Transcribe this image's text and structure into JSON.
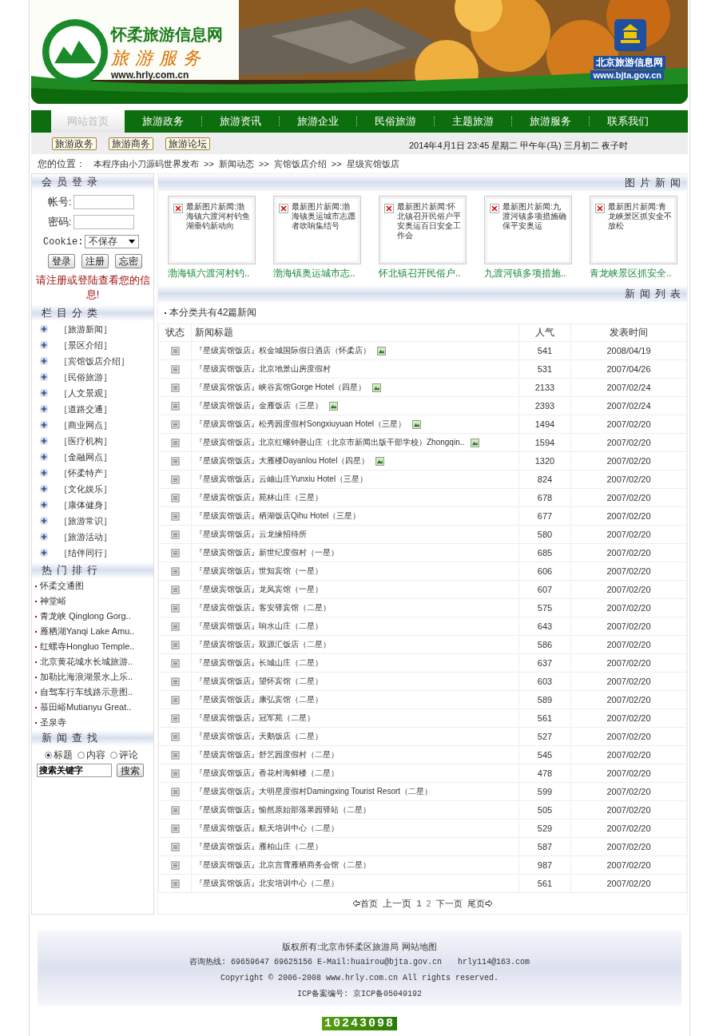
{
  "header": {
    "site_name": "怀柔旅游信息网",
    "slogan": "旅游服务",
    "url": "www.hrly.com.cn",
    "partner_name": "北京旅游信息网",
    "partner_url": "www.bjta.gov.cn"
  },
  "nav": [
    {
      "label": "网站首页",
      "selected": true
    },
    {
      "label": "旅游政务",
      "selected": false
    },
    {
      "label": "旅游资讯",
      "selected": false
    },
    {
      "label": "旅游企业",
      "selected": false
    },
    {
      "label": "民俗旅游",
      "selected": false
    },
    {
      "label": "主题旅游",
      "selected": false
    },
    {
      "label": "旅游服务",
      "selected": false
    },
    {
      "label": "联系我们",
      "selected": false
    }
  ],
  "subnav": {
    "buttons": [
      "旅游政务",
      "旅游商务",
      "旅游论坛"
    ],
    "datetime": "2014年4月1日 23:45 星期二 甲午年(马) 三月初二 夜子时"
  },
  "breadcrumb": {
    "label": "您的位置：",
    "separator": ">>",
    "items": [
      "本程序由小刀源码世界发布",
      "新闻动态",
      "宾馆饭店介绍",
      "星级宾馆饭店"
    ]
  },
  "login": {
    "title": "会员登录",
    "account_label": "帐号:",
    "password_label": "密码:",
    "cookie_label": "Cookie:",
    "cookie_value": "不保存",
    "buttons": [
      "登录",
      "注册",
      "忘密"
    ],
    "notice": "请注册或登陆查看您的信息!"
  },
  "categories": {
    "title": "栏目分类",
    "items": [
      "［旅游新闻］",
      "［景区介绍］",
      "［宾馆饭店介绍］",
      "［民俗旅游］",
      "［人文景观］",
      "［道路交通］",
      "［商业网点］",
      "［医疗机构］",
      "［金融网点］",
      "［怀柔特产］",
      "［文化娱乐］",
      "［康体健身］",
      "［旅游常识］",
      "［旅游活动］",
      "［结伴同行］"
    ]
  },
  "hot": {
    "title": "热门排行",
    "items": [
      "怀柔交通图",
      "神堂峪",
      "青龙峡 Qinglong Gorg..",
      "雁栖湖Yanqi Lake Amu..",
      "红螺寺Hongluo Temple..",
      "北京黄花城水长城旅游..",
      "加勒比海浪湖景水上乐..",
      "自驾车行车线路示意图..",
      "慕田峪Mutianyu Great..",
      "圣泉寺"
    ]
  },
  "search": {
    "title": "新闻查找",
    "options": [
      {
        "label": "标题",
        "selected": true
      },
      {
        "label": "内容",
        "selected": false
      },
      {
        "label": "评论",
        "selected": false
      }
    ],
    "value": "搜索关键字",
    "button": "搜索"
  },
  "photo_news": {
    "title": "图片新闻",
    "items": [
      {
        "alt": "最新图片新闻:渤海镇六渡河村钓鱼湖垂钓新动向",
        "caption": "渤海镇六渡河村钓.."
      },
      {
        "alt": "最新图片新闻:渤海镇奥运城市志愿者吹响集结号",
        "caption": "渤海镇奥运城市志.."
      },
      {
        "alt": "最新图片新闻:怀北镇召开民俗户平安奥运百日安全工作会",
        "caption": "怀北镇召开民俗户.."
      },
      {
        "alt": "最新图片新闻:九渡河镇多项措施确保平安奥运",
        "caption": "九渡河镇多项措施.."
      },
      {
        "alt": "最新图片新闻:青龙峡景区抓安全不放松",
        "caption": "青龙峡景区抓安全.."
      }
    ]
  },
  "news_list": {
    "title": "新闻列表",
    "summary": "本分类共有42篇新闻",
    "columns": [
      "状态",
      "新闻标题",
      "人气",
      "发表时间"
    ],
    "rows": [
      {
        "title": "『星级宾馆饭店』权金城国际假日酒店（怀柔店）",
        "has_image": true,
        "views": "541",
        "date": "2008/04/19"
      },
      {
        "title": "『星级宾馆饭店』北京地景山房度假村",
        "has_image": false,
        "views": "531",
        "date": "2007/04/26"
      },
      {
        "title": "『星级宾馆饭店』峡谷宾馆Gorge Hotel（四星）",
        "has_image": true,
        "views": "2133",
        "date": "2007/02/24"
      },
      {
        "title": "『星级宾馆饭店』金雁饭店（三星）",
        "has_image": true,
        "views": "2393",
        "date": "2007/02/24"
      },
      {
        "title": "『星级宾馆饭店』松秀园度假村Songxiuyuan Hotel（三星）",
        "has_image": true,
        "views": "1494",
        "date": "2007/02/20"
      },
      {
        "title": "『星级宾馆饭店』北京红螺钟磬山庄（北京市新闻出版干部学校）Zhongqin..",
        "has_image": true,
        "views": "1594",
        "date": "2007/02/20"
      },
      {
        "title": "『星级宾馆饭店』大雁楼Dayanlou Hotel（四星）",
        "has_image": true,
        "views": "1320",
        "date": "2007/02/20"
      },
      {
        "title": "『星级宾馆饭店』云岫山庄Yunxiu Hotel（三星）",
        "has_image": false,
        "views": "824",
        "date": "2007/02/20"
      },
      {
        "title": "『星级宾馆饭店』苑林山庄（三星）",
        "has_image": false,
        "views": "678",
        "date": "2007/02/20"
      },
      {
        "title": "『星级宾馆饭店』栖湖饭店Qihu Hotel（三星）",
        "has_image": false,
        "views": "677",
        "date": "2007/02/20"
      },
      {
        "title": "『星级宾馆饭店』云龙缘招待所",
        "has_image": false,
        "views": "580",
        "date": "2007/02/20"
      },
      {
        "title": "『星级宾馆饭店』新世纪度假村（一星）",
        "has_image": false,
        "views": "685",
        "date": "2007/02/20"
      },
      {
        "title": "『星级宾馆饭店』世知宾馆（一星）",
        "has_image": false,
        "views": "606",
        "date": "2007/02/20"
      },
      {
        "title": "『星级宾馆饭店』龙凤宾馆（一星）",
        "has_image": false,
        "views": "607",
        "date": "2007/02/20"
      },
      {
        "title": "『星级宾馆饭店』客安驿宾馆（二星）",
        "has_image": false,
        "views": "575",
        "date": "2007/02/20"
      },
      {
        "title": "『星级宾馆饭店』响水山庄（二星）",
        "has_image": false,
        "views": "643",
        "date": "2007/02/20"
      },
      {
        "title": "『星级宾馆饭店』双源汇饭店（二星）",
        "has_image": false,
        "views": "586",
        "date": "2007/02/20"
      },
      {
        "title": "『星级宾馆饭店』长城山庄（二星）",
        "has_image": false,
        "views": "637",
        "date": "2007/02/20"
      },
      {
        "title": "『星级宾馆饭店』望怀宾馆（二星）",
        "has_image": false,
        "views": "603",
        "date": "2007/02/20"
      },
      {
        "title": "『星级宾馆饭店』康弘宾馆（二星）",
        "has_image": false,
        "views": "589",
        "date": "2007/02/20"
      },
      {
        "title": "『星级宾馆饭店』冠军苑（二星）",
        "has_image": false,
        "views": "561",
        "date": "2007/02/20"
      },
      {
        "title": "『星级宾馆饭店』天鹅饭店（二星）",
        "has_image": false,
        "views": "527",
        "date": "2007/02/20"
      },
      {
        "title": "『星级宾馆饭店』舒艺园度假村（二星）",
        "has_image": false,
        "views": "545",
        "date": "2007/02/20"
      },
      {
        "title": "『星级宾馆饭店』香花村海鲜楼（二星）",
        "has_image": false,
        "views": "478",
        "date": "2007/02/20"
      },
      {
        "title": "『星级宾馆饭店』大明星度假村Damingxing Tourist Resort（二星）",
        "has_image": false,
        "views": "599",
        "date": "2007/02/20"
      },
      {
        "title": "『星级宾馆饭店』愉然原始部落果园驿站（二星）",
        "has_image": false,
        "views": "505",
        "date": "2007/02/20"
      },
      {
        "title": "『星级宾馆饭店』航天培训中心（二星）",
        "has_image": false,
        "views": "529",
        "date": "2007/02/20"
      },
      {
        "title": "『星级宾馆饭店』雁柏山庄（二星）",
        "has_image": false,
        "views": "587",
        "date": "2007/02/20"
      },
      {
        "title": "『星级宾馆饭店』北京宫霄雁栖商务会馆（二星）",
        "has_image": false,
        "views": "987",
        "date": "2007/02/20"
      },
      {
        "title": "『星级宾馆饭店』北安培训中心（二星）",
        "has_image": false,
        "views": "561",
        "date": "2007/02/20"
      }
    ],
    "pagination": {
      "first": "首页",
      "prev": "上一页",
      "pages": [
        {
          "label": "1",
          "selected": true
        },
        {
          "label": "2",
          "selected": false
        }
      ],
      "next": "下一页",
      "last": "尾页"
    }
  },
  "footer": {
    "copyright_owner": "版权所有:北京市怀柔区旅游局",
    "sitemap": "网站地图",
    "hotline": "咨询热线: 69659647 69625156 E-Mail:huairou@bjta.gov.cn",
    "email2": "hrly114@163.com",
    "copyright": "Copyright © 2006-2008 www.hrly.com.cn All rights reserved.",
    "icp": "ICP备案编号: 京ICP备05049192",
    "counter": "10243098"
  }
}
